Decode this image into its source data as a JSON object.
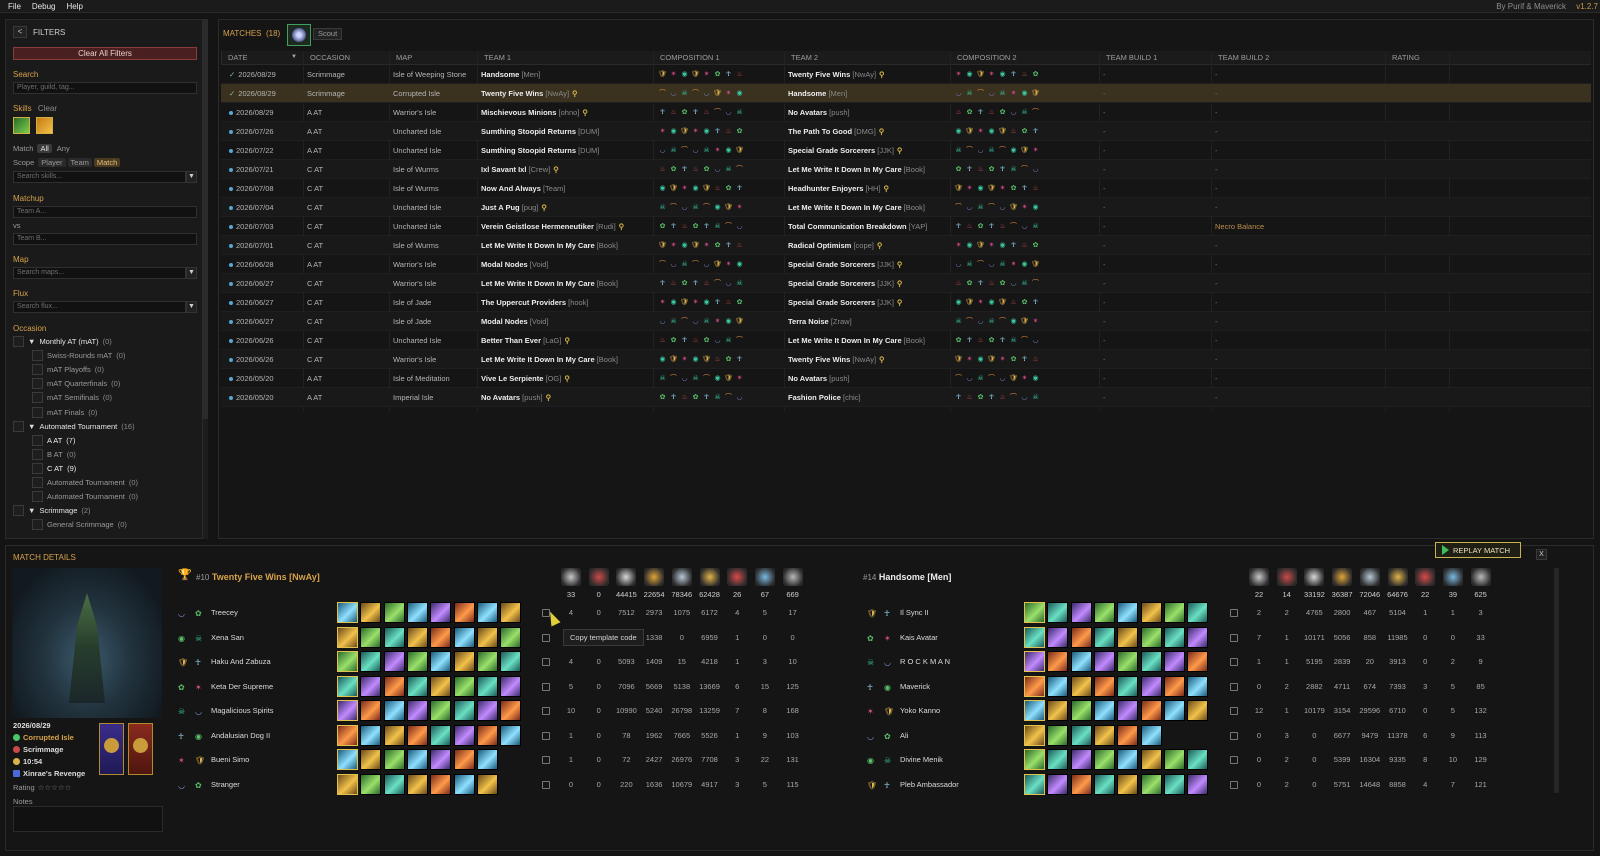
{
  "menubar": {
    "items": [
      "File",
      "Debug",
      "Help"
    ],
    "credit": "By Purif & Maverick",
    "version": "v1.2.7"
  },
  "filters": {
    "title": "FILTERS",
    "back_label": "<",
    "clear_all": "Clear All Filters",
    "search_label": "Search",
    "search_placeholder": "Player, guild, tag...",
    "skills_label": "Skills",
    "skills_clear": "Clear",
    "match_label": "Match",
    "match_all": "All",
    "match_any": "Any",
    "scope_label": "Scope",
    "scope_player": "Player",
    "scope_team": "Team",
    "scope_match": "Match",
    "search_skills_placeholder": "Search skills...",
    "matchup_label": "Matchup",
    "team_a_placeholder": "Team A...",
    "vs": "vs",
    "team_b_placeholder": "Team B...",
    "map_label": "Map",
    "map_placeholder": "Search maps...",
    "flux_label": "Flux",
    "flux_placeholder": "Search flux...",
    "occasion_label": "Occasion",
    "occasions": [
      {
        "label": "Monthly AT (mAT)",
        "count": "(0)",
        "level": 0,
        "arrow": "▼"
      },
      {
        "label": "Swiss-Rounds mAT",
        "count": "(0)",
        "level": 1
      },
      {
        "label": "mAT Playoffs",
        "count": "(0)",
        "level": 1
      },
      {
        "label": "mAT Quarterfinals",
        "count": "(0)",
        "level": 1
      },
      {
        "label": "mAT Semifinals",
        "count": "(0)",
        "level": 1
      },
      {
        "label": "mAT Finals",
        "count": "(0)",
        "level": 1
      },
      {
        "label": "Automated Tournament",
        "count": "(16)",
        "level": 0,
        "arrow": "▼"
      },
      {
        "label": "A AT",
        "count": "(7)",
        "level": 1,
        "bright": true
      },
      {
        "label": "B AT",
        "count": "(0)",
        "level": 1
      },
      {
        "label": "C AT",
        "count": "(9)",
        "level": 1,
        "bright": true
      },
      {
        "label": "Automated Tournament",
        "count": "(0)",
        "level": 1
      },
      {
        "label": "Automated Tournament",
        "count": "(0)",
        "level": 1
      },
      {
        "label": "Scrimmage",
        "count": "(2)",
        "level": 0,
        "arrow": "▼"
      },
      {
        "label": "General Scrimmage",
        "count": "(0)",
        "level": 1
      }
    ]
  },
  "matches": {
    "title": "MATCHES",
    "count": "(18)",
    "scout_label": "Scout",
    "columns": [
      "DATE",
      "OCCASION",
      "MAP",
      "TEAM 1",
      "COMPOSITION 1",
      "TEAM 2",
      "COMPOSITION 2",
      "TEAM BUILD 1",
      "TEAM BUILD 2",
      "RATING"
    ],
    "sort_indicator": "▼",
    "rows": [
      {
        "check": "✓",
        "date": "2026/08/29",
        "occasion": "Scrimmage",
        "map": "Isle of Weeping Stone",
        "team1": "Handsome",
        "tag1": "[Men]",
        "cap1": false,
        "team2": "Twenty Five Wins",
        "tag2": "[NwAy]",
        "cap2": true,
        "build1": "-",
        "build2": "-"
      },
      {
        "check": "✓",
        "date": "2026/08/29",
        "occasion": "Scrimmage",
        "map": "Corrupted Isle",
        "team1": "Twenty Five Wins",
        "tag1": "[NwAy]",
        "cap1": true,
        "team2": "Handsome",
        "tag2": "[Men]",
        "cap2": false,
        "build1": "-",
        "build2": "-",
        "selected": true
      },
      {
        "date": "2026/08/29",
        "occasion": "A AT",
        "map": "Warrior's Isle",
        "team1": "Mischievous Minions",
        "tag1": "[ohno]",
        "cap1": true,
        "team2": "No Avatars",
        "tag2": "[push]",
        "cap2": false,
        "build1": "-",
        "build2": "-"
      },
      {
        "date": "2026/07/26",
        "occasion": "A AT",
        "map": "Uncharted Isle",
        "team1": "Sumthing Stoopid Returns",
        "tag1": "[DUM]",
        "cap1": false,
        "team2": "The Path To Good",
        "tag2": "[DMG]",
        "cap2": true,
        "build1": "-",
        "build2": "-"
      },
      {
        "date": "2026/07/22",
        "occasion": "A AT",
        "map": "Uncharted Isle",
        "team1": "Sumthing Stoopid Returns",
        "tag1": "[DUM]",
        "cap1": false,
        "team2": "Special Grade Sorcerers",
        "tag2": "[JJK]",
        "cap2": true,
        "build1": "-",
        "build2": "-"
      },
      {
        "date": "2026/07/21",
        "occasion": "C AT",
        "map": "Isle of Wurms",
        "team1": "Ixl Savant Ixl",
        "tag1": "[Crew]",
        "cap1": true,
        "team2": "Let Me Write It Down In My Care",
        "tag2": "[Book]",
        "cap2": false,
        "build1": "-",
        "build2": "-"
      },
      {
        "date": "2026/07/08",
        "occasion": "C AT",
        "map": "Isle of Wurms",
        "team1": "Now And Always",
        "tag1": "[Team]",
        "cap1": false,
        "team2": "Headhunter Enjoyers",
        "tag2": "[HH]",
        "cap2": true,
        "build1": "-",
        "build2": "-"
      },
      {
        "date": "2026/07/04",
        "occasion": "C AT",
        "map": "Uncharted Isle",
        "team1": "Just A Pug",
        "tag1": "[pug]",
        "cap1": true,
        "team2": "Let Me Write It Down In My Care",
        "tag2": "[Book]",
        "cap2": false,
        "build1": "-",
        "build2": "-"
      },
      {
        "date": "2026/07/03",
        "occasion": "C AT",
        "map": "Uncharted Isle",
        "team1": "Verein Geistlose Hermeneutiker",
        "tag1": "[Rudi]",
        "cap1": true,
        "team2": "Total Communication Breakdown",
        "tag2": "[YAP]",
        "cap2": false,
        "build1": "-",
        "build2": "Necro Balance"
      },
      {
        "date": "2026/07/01",
        "occasion": "C AT",
        "map": "Isle of Wurms",
        "team1": "Let Me Write It Down In My Care",
        "tag1": "[Book]",
        "cap1": false,
        "team2": "Radical Optimism",
        "tag2": "[cope]",
        "cap2": true,
        "build1": "-",
        "build2": "-"
      },
      {
        "date": "2026/06/28",
        "occasion": "A AT",
        "map": "Warrior's Isle",
        "team1": "Modal Nodes",
        "tag1": "[Void]",
        "cap1": false,
        "team2": "Special Grade Sorcerers",
        "tag2": "[JJK]",
        "cap2": true,
        "build1": "-",
        "build2": "-"
      },
      {
        "date": "2026/06/27",
        "occasion": "C AT",
        "map": "Warrior's Isle",
        "team1": "Let Me Write It Down In My Care",
        "tag1": "[Book]",
        "cap1": false,
        "team2": "Special Grade Sorcerers",
        "tag2": "[JJK]",
        "cap2": true,
        "build1": "-",
        "build2": "-"
      },
      {
        "date": "2026/06/27",
        "occasion": "C AT",
        "map": "Isle of Jade",
        "team1": "The Uppercut Providers",
        "tag1": "[hook]",
        "cap1": false,
        "team2": "Special Grade Sorcerers",
        "tag2": "[JJK]",
        "cap2": true,
        "build1": "-",
        "build2": "-"
      },
      {
        "date": "2026/06/27",
        "occasion": "C AT",
        "map": "Isle of Jade",
        "team1": "Modal Nodes",
        "tag1": "[Void]",
        "cap1": false,
        "team2": "Terra Noise",
        "tag2": "[Zraw]",
        "cap2": false,
        "build1": "-",
        "build2": "-"
      },
      {
        "date": "2026/06/26",
        "occasion": "C AT",
        "map": "Uncharted Isle",
        "team1": "Better Than Ever",
        "tag1": "[LaG]",
        "cap1": true,
        "team2": "Let Me Write It Down In My Care",
        "tag2": "[Book]",
        "cap2": false,
        "build1": "-",
        "build2": "-"
      },
      {
        "date": "2026/06/26",
        "occasion": "C AT",
        "map": "Warrior's Isle",
        "team1": "Let Me Write It Down In My Care",
        "tag1": "[Book]",
        "cap1": false,
        "team2": "Twenty Five Wins",
        "tag2": "[NwAy]",
        "cap2": true,
        "build1": "-",
        "build2": "-"
      },
      {
        "date": "2026/05/20",
        "occasion": "A AT",
        "map": "Isle of Meditation",
        "team1": "Vive Le Serpiente",
        "tag1": "[OG]",
        "cap1": true,
        "team2": "No Avatars",
        "tag2": "[push]",
        "cap2": false,
        "build1": "-",
        "build2": "-"
      },
      {
        "date": "2026/05/20",
        "occasion": "A AT",
        "map": "Imperial Isle",
        "team1": "No Avatars",
        "tag1": "[push]",
        "cap1": true,
        "team2": "Fashion Police",
        "tag2": "[chic]",
        "cap2": false,
        "build1": "-",
        "build2": "-"
      }
    ]
  },
  "details": {
    "title": "MATCH DETAILS",
    "replay_label": "REPLAY MATCH",
    "close_label": "X",
    "date": "2026/08/29",
    "map": "Corrupted Isle",
    "occasion": "Scrimmage",
    "time": "10:54",
    "flux": "Xinrae's Revenge",
    "rating_label": "Rating",
    "stars": "☆☆☆☆☆",
    "notes_label": "Notes",
    "tooltip": "Copy template code",
    "team1": {
      "rank": "#10",
      "name": "Twenty Five Wins [NwAy]",
      "totals": [
        "33",
        "0",
        "44415",
        "22654",
        "78346",
        "62428",
        "26",
        "67",
        "669"
      ],
      "players": [
        {
          "name": "Treecey",
          "stats": [
            "4",
            "0",
            "7512",
            "2973",
            "1075",
            "6172",
            "4",
            "5",
            "17"
          ]
        },
        {
          "name": "Xena San",
          "stats": [
            "",
            "",
            "",
            "1338",
            "0",
            "6959",
            "1",
            "0",
            "0"
          ]
        },
        {
          "name": "Haku And Zabuza",
          "stats": [
            "4",
            "0",
            "5093",
            "1409",
            "15",
            "4218",
            "1",
            "3",
            "10"
          ]
        },
        {
          "name": "Keta Der Supreme",
          "stats": [
            "5",
            "0",
            "7096",
            "5669",
            "5138",
            "13669",
            "6",
            "15",
            "125"
          ]
        },
        {
          "name": "Magalicious Spirits",
          "stats": [
            "10",
            "0",
            "10990",
            "5240",
            "26798",
            "13259",
            "7",
            "8",
            "168"
          ]
        },
        {
          "name": "Andalusian Dog II",
          "stats": [
            "1",
            "0",
            "78",
            "1962",
            "7665",
            "5526",
            "1",
            "9",
            "103"
          ]
        },
        {
          "name": "Bueni Simo",
          "stats": [
            "1",
            "0",
            "72",
            "2427",
            "26976",
            "7708",
            "3",
            "22",
            "131"
          ]
        },
        {
          "name": "Stranger",
          "stats": [
            "0",
            "0",
            "220",
            "1636",
            "10679",
            "4917",
            "3",
            "5",
            "115"
          ]
        }
      ]
    },
    "team2": {
      "rank": "#14",
      "name": "Handsome [Men]",
      "totals": [
        "22",
        "14",
        "33192",
        "36387",
        "72046",
        "64676",
        "22",
        "39",
        "625"
      ],
      "players": [
        {
          "name": "Il Sync II",
          "stats": [
            "2",
            "2",
            "4765",
            "2800",
            "467",
            "5104",
            "1",
            "1",
            "3"
          ]
        },
        {
          "name": "Kais Avatar",
          "stats": [
            "7",
            "1",
            "10171",
            "5056",
            "858",
            "11985",
            "0",
            "0",
            "33"
          ]
        },
        {
          "name": "R O C K M A N",
          "stats": [
            "1",
            "1",
            "5195",
            "2839",
            "20",
            "3913",
            "0",
            "2",
            "9"
          ]
        },
        {
          "name": "Maverick",
          "stats": [
            "0",
            "2",
            "2882",
            "4711",
            "674",
            "7393",
            "3",
            "5",
            "85"
          ]
        },
        {
          "name": "Yoko Kanno",
          "stats": [
            "12",
            "1",
            "10179",
            "3154",
            "29596",
            "6710",
            "0",
            "5",
            "132"
          ]
        },
        {
          "name": "Ali",
          "stats": [
            "0",
            "3",
            "0",
            "6677",
            "9479",
            "11378",
            "6",
            "9",
            "113"
          ]
        },
        {
          "name": "Divine Menik",
          "stats": [
            "0",
            "2",
            "0",
            "5399",
            "16304",
            "9335",
            "8",
            "10",
            "129"
          ]
        },
        {
          "name": "Pleb Ambassador",
          "stats": [
            "0",
            "2",
            "0",
            "5751",
            "14648",
            "8858",
            "4",
            "7",
            "121"
          ]
        }
      ]
    }
  }
}
